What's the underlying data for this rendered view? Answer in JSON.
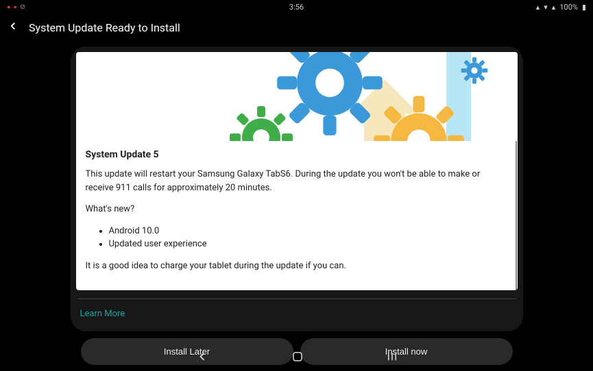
{
  "status": {
    "time": "3:56",
    "battery": "100%"
  },
  "header": {
    "title": "System Update Ready to Install"
  },
  "update": {
    "title": "System Update 5",
    "description": "This update will restart your Samsung Galaxy TabS6. During the update you won't be able to make or receive 911 calls for approximately 20 minutes.",
    "whats_new_label": "What's new?",
    "items": [
      "Android 10.0",
      "Updated user experience"
    ],
    "charge_note": "It is a good idea to charge your tablet during the update if you can."
  },
  "links": {
    "learn_more": "Learn More"
  },
  "buttons": {
    "later": "Install Later",
    "now": "Install now"
  }
}
